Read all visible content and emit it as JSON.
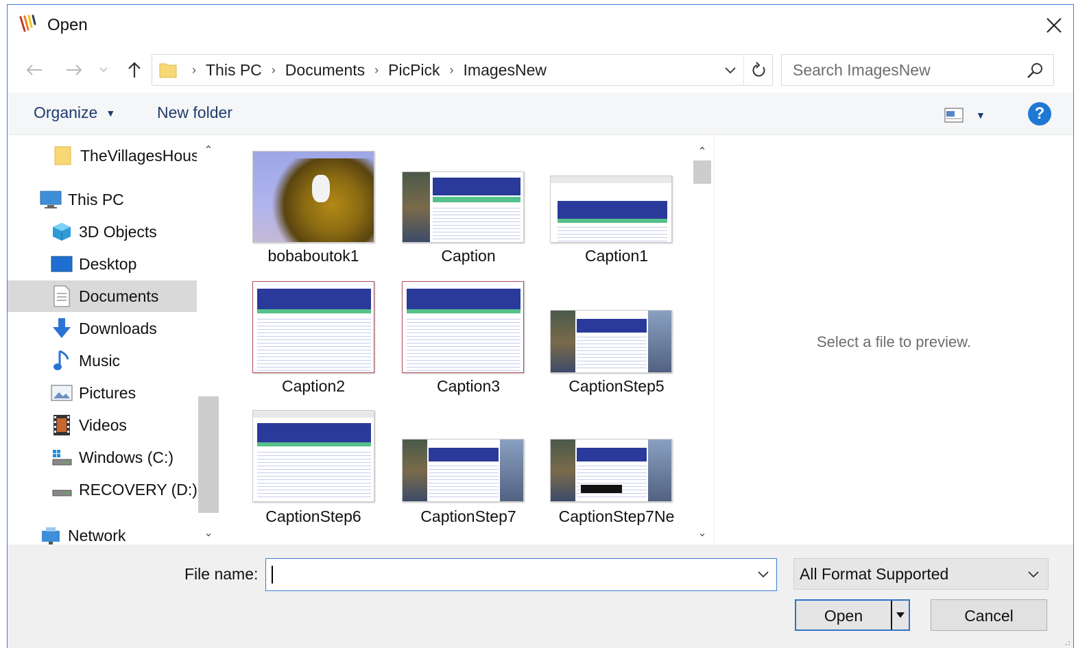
{
  "window": {
    "title": "Open",
    "icon": "picpick-app-icon"
  },
  "nav_buttons": {
    "back": "back-arrow-icon",
    "forward": "forward-arrow-icon",
    "recent": "chevron-down-icon",
    "up": "up-arrow-icon"
  },
  "address": {
    "crumbs": [
      "This PC",
      "Documents",
      "PicPick",
      "ImagesNew"
    ],
    "separator": ">"
  },
  "search": {
    "placeholder": "Search ImagesNew"
  },
  "toolbar": {
    "organize": "Organize",
    "new_folder": "New folder",
    "help": "?"
  },
  "navpane": {
    "items": [
      {
        "label": "TheVillagesHous",
        "icon": "folder-icon"
      },
      {
        "label": "This PC",
        "icon": "computer-icon"
      },
      {
        "label": "3D Objects",
        "icon": "cube-icon"
      },
      {
        "label": "Desktop",
        "icon": "desktop-icon"
      },
      {
        "label": "Documents",
        "icon": "document-icon",
        "selected": true
      },
      {
        "label": "Downloads",
        "icon": "download-arrow-icon"
      },
      {
        "label": "Music",
        "icon": "music-note-icon"
      },
      {
        "label": "Pictures",
        "icon": "picture-icon"
      },
      {
        "label": "Videos",
        "icon": "film-icon"
      },
      {
        "label": "Windows (C:)",
        "icon": "windows-drive-icon"
      },
      {
        "label": "RECOVERY (D:)",
        "icon": "drive-icon"
      },
      {
        "label": "Network",
        "icon": "network-icon"
      }
    ]
  },
  "files": [
    {
      "name": "bobaboutok1",
      "kind": "photo"
    },
    {
      "name": "Caption",
      "kind": "screenshot"
    },
    {
      "name": "Caption1",
      "kind": "screenshot"
    },
    {
      "name": "Caption2",
      "kind": "screenshot"
    },
    {
      "name": "Caption3",
      "kind": "screenshot"
    },
    {
      "name": "CaptionStep5",
      "kind": "screenshot"
    },
    {
      "name": "CaptionStep6",
      "kind": "screenshot"
    },
    {
      "name": "CaptionStep7",
      "kind": "screenshot"
    },
    {
      "name": "CaptionStep7Ne",
      "kind": "screenshot"
    }
  ],
  "preview": {
    "message": "Select a file to preview."
  },
  "bottom": {
    "file_name_label": "File name:",
    "file_name_value": "",
    "filter": "All Format Supported",
    "open": "Open",
    "cancel": "Cancel"
  },
  "colors": {
    "accent": "#3c7dd6",
    "help": "#1e78d4",
    "selection": "#d9d9d9",
    "thumb_header": "#2a3a9a"
  }
}
